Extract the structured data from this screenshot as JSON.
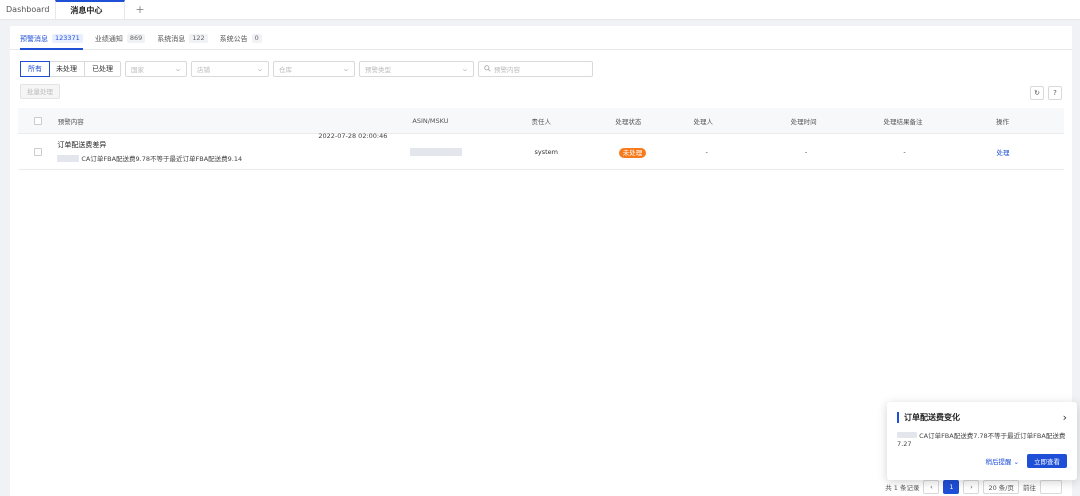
{
  "tabs": {
    "dashboard": "Dashboard",
    "message_center": "消息中心",
    "add": "+"
  },
  "subtabs": [
    {
      "label": "预警消息",
      "count": "123371"
    },
    {
      "label": "业绩通知",
      "count": "869"
    },
    {
      "label": "系统消息",
      "count": "122"
    },
    {
      "label": "系统公告",
      "count": "0"
    }
  ],
  "filters": {
    "segments": [
      "所有",
      "未处理",
      "已处理"
    ],
    "country": "国家",
    "shop": "店铺",
    "warehouse": "仓库",
    "alert_type": "预警类型",
    "search_placeholder": "预警内容"
  },
  "toolbar": {
    "batch": "批量处理",
    "refresh_icon": "↻",
    "help_icon": "?"
  },
  "table": {
    "headers": [
      "预警内容",
      "ASIN/MSKU",
      "责任人",
      "处理状态",
      "处理人",
      "处理时间",
      "处理结果备注",
      "操作"
    ],
    "rows": [
      {
        "title": "订单配送费差异",
        "desc": "CA订单FBA配送费9.78不等于最近订单FBA配送费9.14",
        "time": "2022-07-28 02:00:46",
        "owner": "system",
        "status": "未处理",
        "handler": "-",
        "handle_time": "-",
        "note": "-",
        "op": "处理"
      }
    ]
  },
  "pagination": {
    "total": "共 1 条记录",
    "page": "1",
    "page_size": "20 条/页",
    "goto": "前往"
  },
  "notification": {
    "title": "订单配送费变化",
    "body": "CA订单FBA配送费7.78不等于最近订单FBA配送费7.27",
    "remind": "稍后提醒",
    "view": "立即查看"
  },
  "colors": {
    "primary": "#1e4fd6",
    "status_pending": "#f77b1c"
  }
}
